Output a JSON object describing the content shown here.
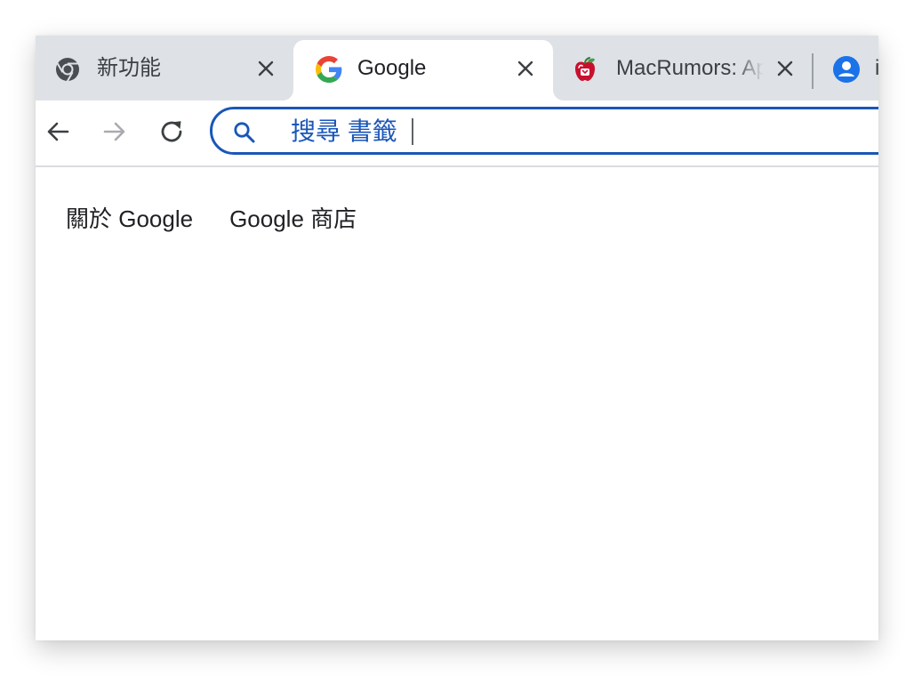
{
  "window": {
    "tabs": [
      {
        "title": "新功能",
        "favicon": "chrome-icon",
        "active": false
      },
      {
        "title": "Google",
        "favicon": "google-g-icon",
        "active": true
      },
      {
        "title": "MacRumors: Apple News and Rumors",
        "favicon": "macrumors-icon",
        "active": false
      },
      {
        "title": "i",
        "favicon": "profile-icon",
        "active": false
      }
    ],
    "tab_close_icon": "close-icon"
  },
  "toolbar": {
    "back_icon": "arrow-left-icon",
    "forward_icon": "arrow-right-icon",
    "reload_icon": "reload-icon",
    "omnibox": {
      "icon": "search-icon",
      "placeholder": "搜尋 書籤",
      "value": ""
    }
  },
  "page": {
    "links": [
      "關於 Google",
      "Google 商店"
    ]
  },
  "colors": {
    "tabstrip_bg": "#dee1e6",
    "omnibox_accent": "#1a56b8",
    "google_blue": "#4285F4",
    "google_red": "#EA4335",
    "google_yellow": "#FBBC05",
    "google_green": "#34A853"
  }
}
